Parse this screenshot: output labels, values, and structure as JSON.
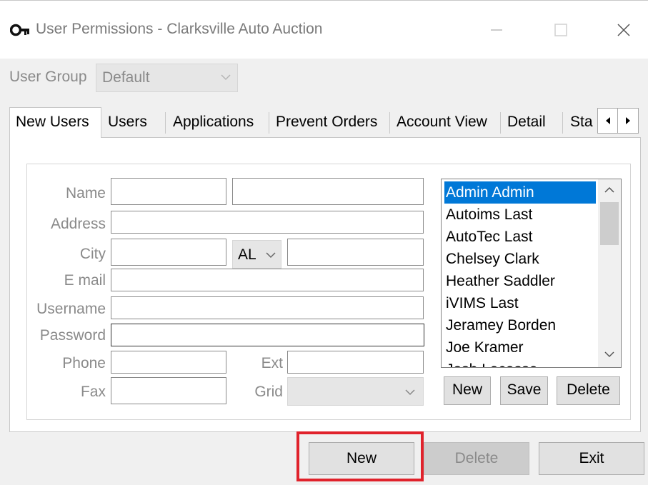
{
  "window": {
    "title": "User Permissions - Clarksville Auto Auction",
    "icon": "key-icon",
    "controls": [
      "minimize-icon",
      "maximize-icon",
      "close-icon"
    ]
  },
  "user_group": {
    "label": "User Group",
    "value": "Default"
  },
  "tabs": [
    {
      "label": "New Users",
      "active": true
    },
    {
      "label": "Users"
    },
    {
      "label": "Applications"
    },
    {
      "label": "Prevent Orders"
    },
    {
      "label": "Account View"
    },
    {
      "label": "Detail"
    },
    {
      "label": "Sta"
    }
  ],
  "form": {
    "name_label": "Name",
    "first_name": "",
    "last_name": "",
    "address_label": "Address",
    "address": "",
    "city_label": "City",
    "city": "",
    "state": "AL",
    "zip": "",
    "email_label": "E mail",
    "email": "",
    "username_label": "Username",
    "username": "",
    "password_label": "Password",
    "password": "",
    "phone_label": "Phone",
    "phone": "",
    "ext_label": "Ext",
    "ext": "",
    "fax_label": "Fax",
    "fax": "",
    "grid_label": "Grid",
    "grid": ""
  },
  "user_list": {
    "items": [
      "Admin Admin",
      "Autoims Last",
      "AutoTec Last",
      "Chelsey Clark",
      "Heather Saddler",
      "iVIMS Last",
      "Jeramey Borden",
      "Joe Kramer",
      "Josh Lacasse"
    ],
    "selected": "Admin Admin",
    "buttons": {
      "new": "New",
      "save": "Save",
      "delete": "Delete"
    }
  },
  "footer": {
    "new": "New",
    "delete": "Delete",
    "exit": "Exit"
  },
  "colors": {
    "selection": "#0078d7",
    "highlight_box": "#e0222b"
  }
}
